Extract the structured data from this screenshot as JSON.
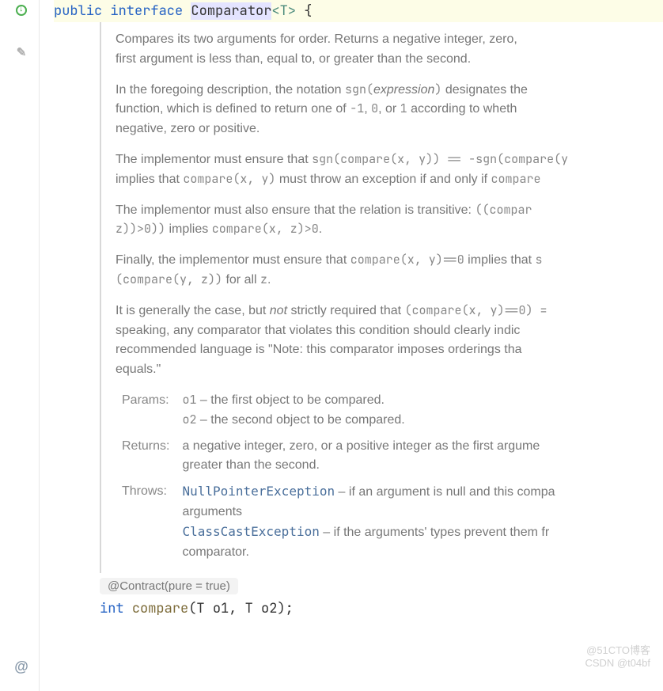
{
  "gutter": {
    "override_tip": "↓",
    "edit_glyph": "✎",
    "at_glyph": "@"
  },
  "code_top": {
    "kw_public": "public",
    "kw_interface": "interface",
    "typename": "Comparator",
    "generic": "<T>",
    "brace": " {"
  },
  "doc": {
    "p1_a": "Compares its two arguments for order. Returns a negative integer, zero, ",
    "p1_b": "first argument is less than, equal to, or greater than the second.",
    "p2_a": "In the foregoing description, the notation ",
    "p2_sgn": "sgn(",
    "p2_expr": "expression",
    "p2_close": ")",
    "p2_b": " designates the",
    "p2_c": "function, which is defined to return one of ",
    "p2_m1": "-1",
    "p2_c2": ", ",
    "p2_0": "0",
    "p2_c3": ", or ",
    "p2_1": "1",
    "p2_d": " according to wheth",
    "p2_e": "negative, zero or positive.",
    "p3_a": "The implementor must ensure that ",
    "p3_code1": "sgn(compare(x, y)) == -sgn(compare(y",
    "p3_b": "implies that ",
    "p3_code2": "compare(x, y)",
    "p3_c": " must throw an exception if and only if ",
    "p3_code3": "compare",
    "p4_a": "The implementor must also ensure that the relation is transitive: ",
    "p4_code1": "((compar",
    "p4_code2": "z))>0))",
    "p4_b": " implies ",
    "p4_code3": "compare(x, z)>0",
    "p4_c": ".",
    "p5_a": "Finally, the implementor must ensure that ",
    "p5_code1": "compare(x, y)==0",
    "p5_b": " implies that ",
    "p5_code1b": "s",
    "p5_code2": "(compare(y, z))",
    "p5_c": " for all ",
    "p5_code3": "z",
    "p5_d": ".",
    "p6_a": "It is generally the case, but ",
    "p6_not": "not",
    "p6_b": " strictly required that ",
    "p6_code1": "(compare(x, y)==0) =",
    "p6_c": "speaking, any comparator that violates this condition should clearly indic",
    "p6_d": "recommended language is \"Note: this comparator imposes orderings tha",
    "p6_e": "equals.\"",
    "params_label": "Params:",
    "params_o1": "o1",
    "params_o1_desc": " – the first object to be compared.",
    "params_o2": "o2",
    "params_o2_desc": " – the second object to be compared.",
    "returns_label": "Returns:",
    "returns_desc_a": "a negative integer, zero, or a positive integer as the first argume",
    "returns_desc_b": "greater than the second.",
    "throws_label": "Throws:",
    "throws_npe": "NullPointerException",
    "throws_npe_desc_a": " – if an argument is null and this compa",
    "throws_npe_desc_b": "arguments",
    "throws_cce": "ClassCastException",
    "throws_cce_desc_a": " – if the arguments' types prevent them fr",
    "throws_cce_desc_b": "comparator."
  },
  "contract": "@Contract(pure = true)",
  "sig": {
    "ret": "int",
    "method": "compare",
    "open": "(",
    "t1": "T",
    "p1": " o1",
    "comma": ", ",
    "t2": "T",
    "p2": " o2",
    "close": ");"
  },
  "watermark": "@51CTO博客\nCSDN @t04bf"
}
